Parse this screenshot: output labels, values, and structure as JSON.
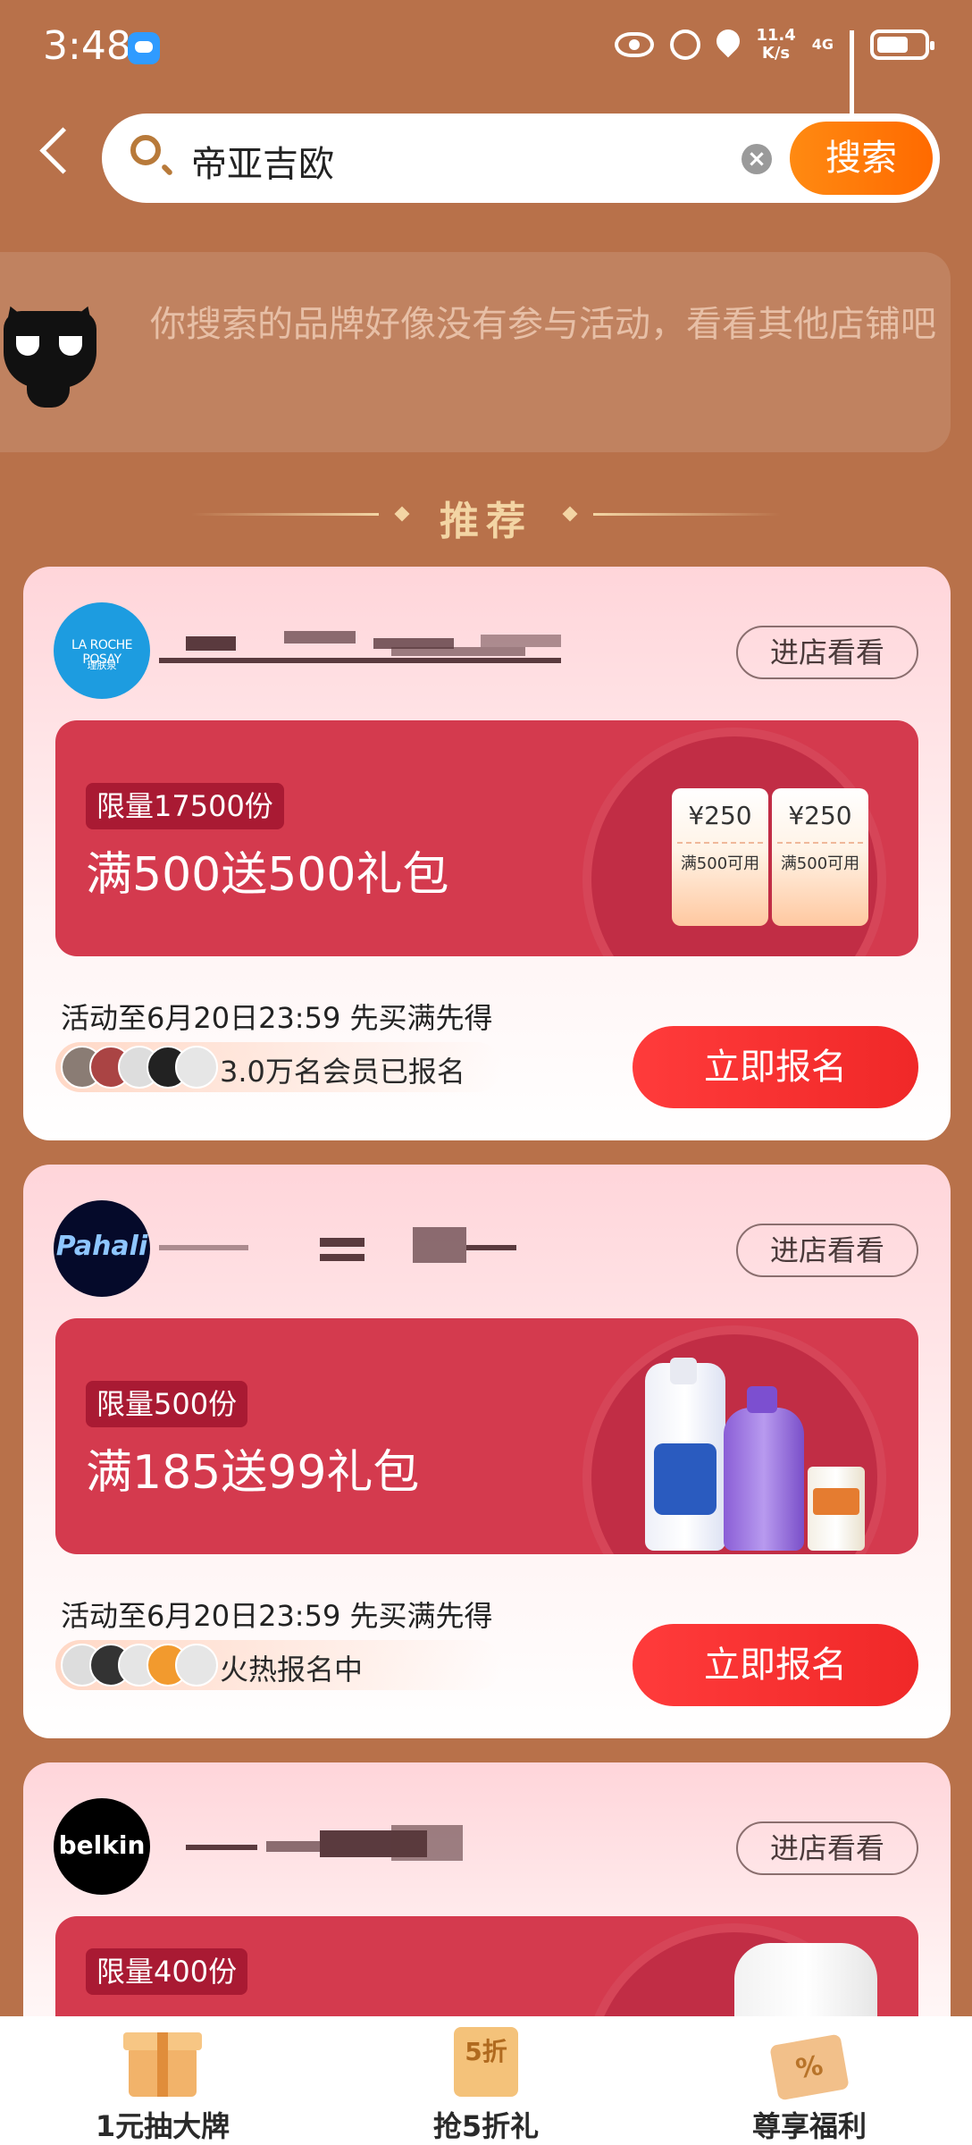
{
  "status_bar": {
    "time": "3:48",
    "net_speed_top": "11.4",
    "net_speed_unit": "K/s",
    "network": "4G"
  },
  "search": {
    "query": "帝亚吉欧",
    "button_label": "搜索"
  },
  "notice": {
    "text": "你搜索的品牌好像没有参与活动，看看其他店铺吧"
  },
  "section": {
    "title": "推荐"
  },
  "cards": [
    {
      "logo_text": "LA ROCHE POSAY",
      "logo_sub": "理肤泉",
      "visit_label": "进店看看",
      "limit": "限量17500份",
      "offer": "满500送500礼包",
      "coupons": [
        {
          "value": "¥250",
          "cond": "满500可用"
        },
        {
          "value": "¥250",
          "cond": "满500可用"
        }
      ],
      "period": "活动至6月20日23:59 先买满先得",
      "members": "3.0万名会员已报名",
      "signup_label": "立即报名"
    },
    {
      "logo_text": "Pahali",
      "visit_label": "进店看看",
      "limit": "限量500份",
      "offer": "满185送99礼包",
      "period": "活动至6月20日23:59 先买满先得",
      "members": "火热报名中",
      "signup_label": "立即报名"
    },
    {
      "logo_text": "belkin",
      "visit_label": "进店看看",
      "limit": "限量400份"
    }
  ],
  "tabbar": {
    "items": [
      {
        "label": "1元抽大牌",
        "icon": "gift-box-icon"
      },
      {
        "label": "抢5折礼",
        "icon": "half-price-box-icon",
        "badge": "5折"
      },
      {
        "label": "尊享福利",
        "icon": "coupon-ticket-icon",
        "badge": "%"
      }
    ]
  },
  "colors": {
    "background": "#b8714a",
    "accent": "#ff6a00",
    "promo": "#d43a4e",
    "signup": "#f02828"
  }
}
